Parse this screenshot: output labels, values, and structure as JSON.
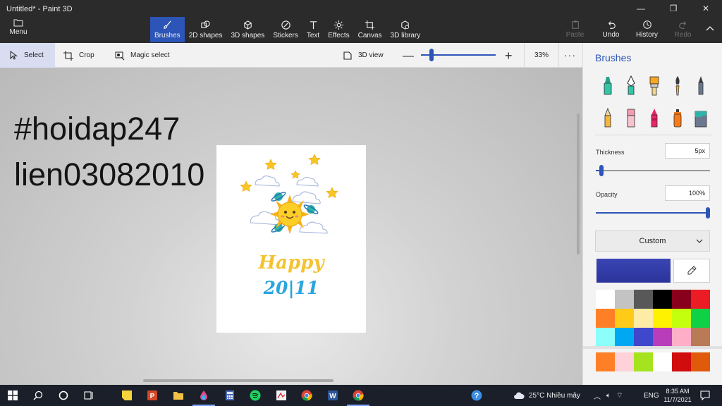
{
  "window": {
    "title": "Untitled* - Paint 3D",
    "minimize": "—",
    "maximize": "❐",
    "close": "✕"
  },
  "menu": {
    "label": "Menu"
  },
  "tools": [
    {
      "label": "Brushes",
      "icon": "brush-icon"
    },
    {
      "label": "2D shapes",
      "icon": "2d-shapes-icon"
    },
    {
      "label": "3D shapes",
      "icon": "3d-shapes-icon"
    },
    {
      "label": "Stickers",
      "icon": "stickers-icon"
    },
    {
      "label": "Text",
      "icon": "text-icon"
    },
    {
      "label": "Effects",
      "icon": "effects-icon"
    },
    {
      "label": "Canvas",
      "icon": "canvas-icon"
    },
    {
      "label": "3D library",
      "icon": "3d-library-icon"
    }
  ],
  "actions": {
    "paste": "Paste",
    "undo": "Undo",
    "history": "History",
    "redo": "Redo"
  },
  "subbar": {
    "select": "Select",
    "crop": "Crop",
    "magic_select": "Magic select",
    "view3d": "3D view",
    "zoom": "33%",
    "more": "···",
    "zoom_minus": "—",
    "zoom_plus": "+",
    "zoom_fraction": 0.33
  },
  "workspace": {
    "line1": "#hoidap247",
    "line2": "lien03082010"
  },
  "artwork": {
    "happy": "Happy",
    "date": "20|11"
  },
  "panel": {
    "title": "Brushes",
    "thickness_label": "Thickness",
    "thickness_value": "5px",
    "thickness_fraction": 0.05,
    "opacity_label": "Opacity",
    "opacity_value": "100%",
    "opacity_fraction": 1.0,
    "dropdown": "Custom",
    "current_color": "#3a45b4",
    "brushes": [
      "marker-brush-icon",
      "calligraphy-pen-icon",
      "oil-brush-icon",
      "watercolor-brush-icon",
      "pixel-pen-icon",
      "pencil-icon",
      "eraser-icon",
      "crayon-icon",
      "spray-can-icon",
      "fill-bucket-icon"
    ],
    "palette": [
      "#ffffff",
      "#c3c3c3",
      "#585858",
      "#000000",
      "#88001b",
      "#ec1c24",
      "#ff7f27",
      "#ffca18",
      "#fdeca6",
      "#fff200",
      "#c4ff0e",
      "#0ed145",
      "#8cfffb",
      "#00a8f3",
      "#3f48cc",
      "#b83dba",
      "#ffaec8",
      "#b97a56"
    ],
    "custom_palette": [
      "#ff7f27",
      "#ffd1d8",
      "#a5e31e",
      "#ffffff",
      "#d00c0c",
      "#e05a0b"
    ]
  },
  "taskbar": {
    "weather": "25°C  Nhiều mây",
    "lang": "ENG",
    "time": "8:35 AM",
    "date": "11/7/2021"
  }
}
